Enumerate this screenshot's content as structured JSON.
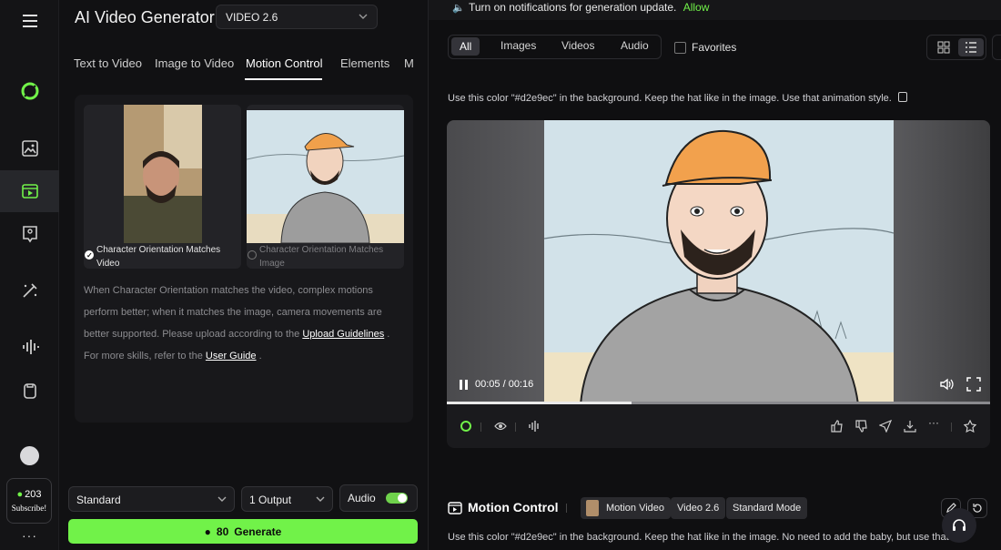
{
  "app": {
    "title": "AI Video Generator",
    "model": "VIDEO 2.6"
  },
  "tabs": [
    "Text to Video",
    "Image to Video",
    "Motion Control",
    "Elements",
    "M"
  ],
  "orientation": {
    "option_video": "Character Orientation Matches Video",
    "option_image": "Character Orientation Matches Image",
    "desc_1": "When Character Orientation matches the video, complex motions perform better; when it matches the image, camera movements are better supported. Please upload according to the",
    "link_guidelines": "Upload Guidelines",
    "desc_2": ". For more skills, refer to the",
    "link_guide": "User Guide",
    "desc_3": "."
  },
  "controls": {
    "mode": "Standard",
    "outputs": "1 Output",
    "audio_label": "Audio",
    "audio_on": true
  },
  "generate": {
    "cost": "80",
    "label": "Generate"
  },
  "credits": {
    "count": "203",
    "subscribe": "Subscribe!"
  },
  "rail_more": "···",
  "notification": {
    "text": "Turn on notifications for generation update.",
    "action": "Allow"
  },
  "filters": {
    "all": "All",
    "images": "Images",
    "videos": "Videos",
    "audio": "Audio",
    "favorites": "Favorites"
  },
  "item1": {
    "prompt": "Use this color \"#d2e9ec\" in the background. Keep the hat like in the image. Use that animation style.",
    "time": "00:05 / 00:16",
    "progress": 0.34
  },
  "item2": {
    "title": "Motion Control",
    "chips": [
      "Motion Video",
      "Video 2.6",
      "Standard Mode"
    ],
    "prompt": "Use this color \"#d2e9ec\" in the background. Keep the hat like in the image. No need to add the baby, but use that"
  },
  "colors": {
    "accent": "#71f249",
    "bg": "#0c0c0e",
    "frame_bg": "#d2e2e9"
  }
}
